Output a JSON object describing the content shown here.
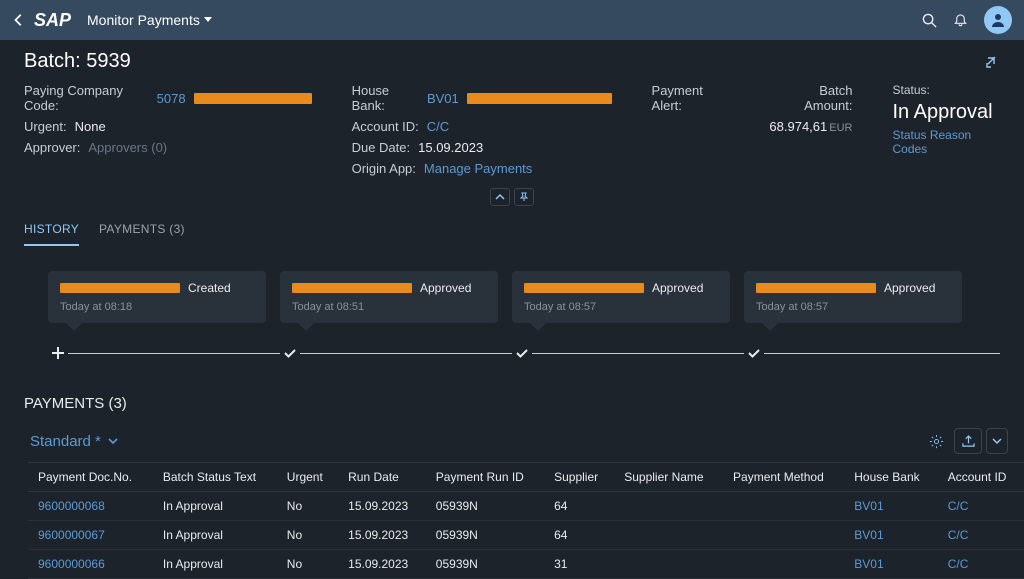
{
  "header": {
    "app_title": "Monitor Payments"
  },
  "page": {
    "title": "Batch: 5939"
  },
  "details": {
    "col1": {
      "paying_cc_label": "Paying Company Code:",
      "paying_cc_value": "5078",
      "urgent_label": "Urgent:",
      "urgent_value": "None",
      "approver_label": "Approver:",
      "approver_value": "Approvers (0)"
    },
    "col2": {
      "house_bank_label": "House Bank:",
      "house_bank_value": "BV01",
      "account_id_label": "Account ID:",
      "account_id_value": "C/C",
      "due_date_label": "Due Date:",
      "due_date_value": "15.09.2023",
      "origin_app_label": "Origin App:",
      "origin_app_value": "Manage Payments"
    },
    "payment_alert_label": "Payment Alert:",
    "amount": {
      "label": "Batch Amount:",
      "value": "68.974,61",
      "currency": "EUR"
    },
    "status": {
      "label": "Status:",
      "value": "In Approval",
      "reason_link": "Status Reason Codes"
    }
  },
  "tabs": {
    "history": "HISTORY",
    "payments": "PAYMENTS (3)"
  },
  "history": [
    {
      "action": "Created",
      "time": "Today at 08:18",
      "icon": "plus"
    },
    {
      "action": "Approved",
      "time": "Today at 08:51",
      "icon": "check"
    },
    {
      "action": "Approved",
      "time": "Today at 08:57",
      "icon": "check"
    },
    {
      "action": "Approved",
      "time": "Today at 08:57",
      "icon": "check"
    }
  ],
  "payments_section": {
    "title": "PAYMENTS (3)",
    "variant": "Standard *"
  },
  "table": {
    "cols": [
      "Payment Doc.No.",
      "Batch Status Text",
      "Urgent",
      "Run Date",
      "Payment Run ID",
      "Supplier",
      "Supplier Name",
      "Payment Method",
      "House Bank",
      "Account ID"
    ],
    "rows": [
      {
        "doc": "9600000068",
        "status": "In Approval",
        "urgent": "No",
        "run_date": "15.09.2023",
        "run_id": "05939N",
        "supplier": "64",
        "supplier_name": "",
        "method": "",
        "house_bank": "BV01",
        "account_id": "C/C"
      },
      {
        "doc": "9600000067",
        "status": "In Approval",
        "urgent": "No",
        "run_date": "15.09.2023",
        "run_id": "05939N",
        "supplier": "64",
        "supplier_name": "",
        "method": "",
        "house_bank": "BV01",
        "account_id": "C/C"
      },
      {
        "doc": "9600000066",
        "status": "In Approval",
        "urgent": "No",
        "run_date": "15.09.2023",
        "run_id": "05939N",
        "supplier": "31",
        "supplier_name": "",
        "method": "",
        "house_bank": "BV01",
        "account_id": "C/C"
      }
    ]
  }
}
